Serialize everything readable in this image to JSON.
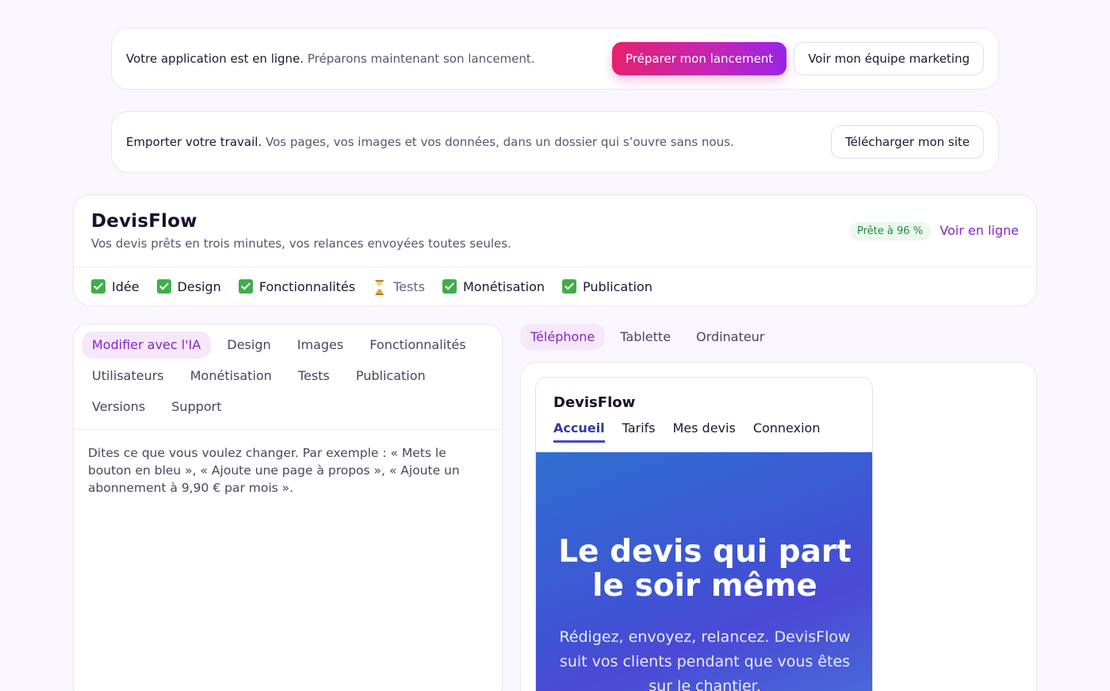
{
  "launch_banner": {
    "lead": "Votre application est en ligne.",
    "sub": "Préparons maintenant son lancement.",
    "primary_button": "Préparer mon lancement",
    "secondary_button": "Voir mon équipe marketing"
  },
  "export_banner": {
    "lead": "Emporter votre travail.",
    "sub": "Vos pages, vos images et vos données, dans un dossier qui s’ouvre sans nous.",
    "button": "Télécharger mon site"
  },
  "project": {
    "name": "DevisFlow",
    "tagline": "Vos devis prêts en trois minutes, vos relances envoyées toutes seules.",
    "readiness": "Prête à 96 %",
    "view_online": "Voir en ligne",
    "steps": [
      {
        "label": "Idée",
        "status": "done",
        "icon": "check-icon"
      },
      {
        "label": "Design",
        "status": "done",
        "icon": "check-icon"
      },
      {
        "label": "Fonctionnalités",
        "status": "done",
        "icon": "check-icon"
      },
      {
        "label": "Tests",
        "status": "pending",
        "icon": "hourglass-icon"
      },
      {
        "label": "Monétisation",
        "status": "done",
        "icon": "check-icon"
      },
      {
        "label": "Publication",
        "status": "done",
        "icon": "check-icon"
      }
    ]
  },
  "editor": {
    "tabs": [
      "Modifier avec l'IA",
      "Design",
      "Images",
      "Fonctionnalités",
      "Utilisateurs",
      "Monétisation",
      "Tests",
      "Publication",
      "Versions",
      "Support"
    ],
    "active_tab": "Modifier avec l'IA",
    "prompt": "Dites ce que vous voulez changer. Par exemple : « Mets le bouton en bleu », « Ajoute une page à propos », « Ajoute un abonnement à 9,90 € par mois »."
  },
  "device_tabs": {
    "items": [
      "Téléphone",
      "Tablette",
      "Ordinateur"
    ],
    "active": "Téléphone"
  },
  "preview": {
    "brand": "DevisFlow",
    "nav": [
      "Accueil",
      "Tarifs",
      "Mes devis",
      "Connexion"
    ],
    "nav_active": "Accueil",
    "hero_title": "Le devis qui part le soir même",
    "hero_text": "Rédigez, envoyez, relancez. DevisFlow suit vos clients pendant que vous êtes sur le chantier."
  },
  "colors": {
    "accent": "#8a22c9",
    "gradient_start": "#e6206e",
    "gradient_end": "#9a23e6",
    "success": "#3fae49",
    "hero_blue": "#3f53d4"
  }
}
